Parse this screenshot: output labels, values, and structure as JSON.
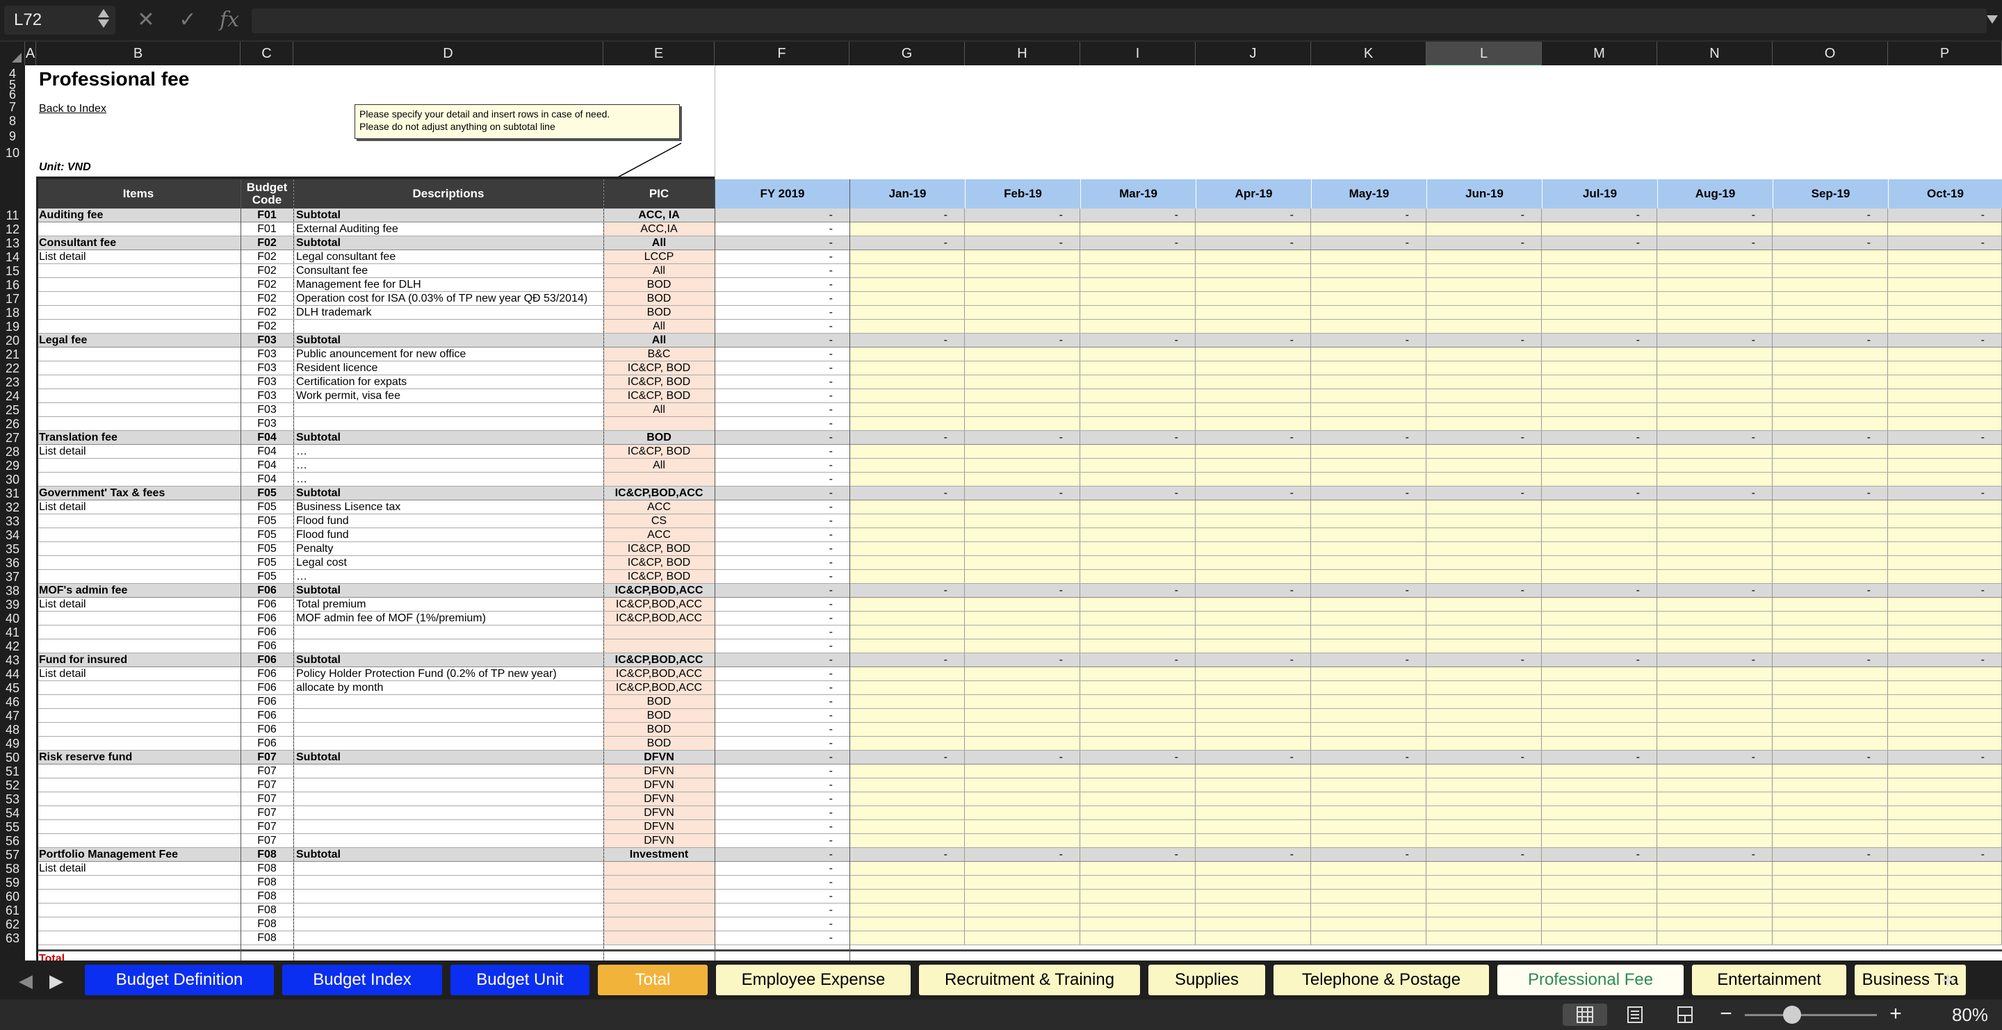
{
  "formula_bar": {
    "name_box": "L72",
    "cancel_icon": "✕",
    "enter_icon": "✓",
    "fx_label": "fx",
    "formula": ""
  },
  "columns": [
    "A",
    "B",
    "C",
    "D",
    "E",
    "F",
    "G",
    "H",
    "I",
    "J",
    "K",
    "L",
    "M",
    "N",
    "O",
    "P"
  ],
  "selected_column": "L",
  "title": "Professional fee",
  "back_link": "Back to Index",
  "unit": "Unit: VND",
  "note": {
    "line1": "Please specify your detail and insert rows in case of need.",
    "line2": "Please do not adjust anything on subtotal line"
  },
  "headers": {
    "items": "Items",
    "budget_code": "Budget Code",
    "descriptions": "Descriptions",
    "pic": "PIC"
  },
  "months": [
    "FY 2019",
    "Jan-19",
    "Feb-19",
    "Mar-19",
    "Apr-19",
    "May-19",
    "Jun-19",
    "Jul-19",
    "Aug-19",
    "Sep-19",
    "Oct-19"
  ],
  "top_row_numbers": [
    "4",
    "5",
    "6",
    "7",
    "8",
    "9",
    "10"
  ],
  "rows": [
    {
      "n": "11",
      "item": "Auditing fee",
      "code": "F01",
      "desc": "Subtotal",
      "pic": "ACC, IA",
      "sub": true
    },
    {
      "n": "12",
      "item": "",
      "code": "F01",
      "desc": "External Auditing fee",
      "pic": "ACC,IA",
      "sub": false
    },
    {
      "n": "13",
      "item": "Consultant fee",
      "code": "F02",
      "desc": "Subtotal",
      "pic": "All",
      "sub": true
    },
    {
      "n": "14",
      "item": "List detail",
      "code": "F02",
      "desc": "Legal consultant fee",
      "pic": "LCCP",
      "sub": false
    },
    {
      "n": "15",
      "item": "",
      "code": "F02",
      "desc": "Consultant fee",
      "pic": "All",
      "sub": false
    },
    {
      "n": "16",
      "item": "",
      "code": "F02",
      "desc": "Management fee for DLH",
      "pic": "BOD",
      "sub": false
    },
    {
      "n": "17",
      "item": "",
      "code": "F02",
      "desc": "Operation cost for ISA (0.03% of TP new year QĐ 53/2014)",
      "pic": "BOD",
      "sub": false
    },
    {
      "n": "18",
      "item": "",
      "code": "F02",
      "desc": "DLH trademark",
      "pic": "BOD",
      "sub": false
    },
    {
      "n": "19",
      "item": "",
      "code": "F02",
      "desc": "",
      "pic": "All",
      "sub": false
    },
    {
      "n": "20",
      "item": "Legal fee",
      "code": "F03",
      "desc": "Subtotal",
      "pic": "All",
      "sub": true
    },
    {
      "n": "21",
      "item": "",
      "code": "F03",
      "desc": "Public anouncement for new office",
      "pic": "B&C",
      "sub": false
    },
    {
      "n": "22",
      "item": "",
      "code": "F03",
      "desc": "Resident licence",
      "pic": "IC&CP, BOD",
      "sub": false
    },
    {
      "n": "23",
      "item": "",
      "code": "F03",
      "desc": "Certification for expats",
      "pic": "IC&CP, BOD",
      "sub": false
    },
    {
      "n": "24",
      "item": "",
      "code": "F03",
      "desc": "Work permit, visa fee",
      "pic": "IC&CP, BOD",
      "sub": false
    },
    {
      "n": "25",
      "item": "",
      "code": "F03",
      "desc": "",
      "pic": "All",
      "sub": false
    },
    {
      "n": "26",
      "item": "",
      "code": "F03",
      "desc": "",
      "pic": "",
      "sub": false
    },
    {
      "n": "27",
      "item": "Translation fee",
      "code": "F04",
      "desc": "Subtotal",
      "pic": "BOD",
      "sub": true
    },
    {
      "n": "28",
      "item": "List detail",
      "code": "F04",
      "desc": "…",
      "pic": "IC&CP, BOD",
      "sub": false
    },
    {
      "n": "29",
      "item": "",
      "code": "F04",
      "desc": "…",
      "pic": "All",
      "sub": false
    },
    {
      "n": "30",
      "item": "",
      "code": "F04",
      "desc": "…",
      "pic": "",
      "sub": false
    },
    {
      "n": "31",
      "item": "Government' Tax & fees",
      "code": "F05",
      "desc": "Subtotal",
      "pic": "IC&CP,BOD,ACC",
      "sub": true
    },
    {
      "n": "32",
      "item": "List detail",
      "code": "F05",
      "desc": "Business Lisence tax",
      "pic": "ACC",
      "sub": false
    },
    {
      "n": "33",
      "item": "",
      "code": "F05",
      "desc": "Flood fund",
      "pic": "CS",
      "sub": false
    },
    {
      "n": "34",
      "item": "",
      "code": "F05",
      "desc": "Flood fund",
      "pic": "ACC",
      "sub": false
    },
    {
      "n": "35",
      "item": "",
      "code": "F05",
      "desc": "Penalty",
      "pic": "IC&CP, BOD",
      "sub": false
    },
    {
      "n": "36",
      "item": "",
      "code": "F05",
      "desc": "Legal cost",
      "pic": "IC&CP, BOD",
      "sub": false
    },
    {
      "n": "37",
      "item": "",
      "code": "F05",
      "desc": "…",
      "pic": "IC&CP, BOD",
      "sub": false
    },
    {
      "n": "38",
      "item": "MOF's admin fee",
      "code": "F06",
      "desc": "Subtotal",
      "pic": "IC&CP,BOD,ACC",
      "sub": true
    },
    {
      "n": "39",
      "item": "List detail",
      "code": "F06",
      "desc": "Total premium",
      "pic": "IC&CP,BOD,ACC",
      "sub": false
    },
    {
      "n": "40",
      "item": "",
      "code": "F06",
      "desc": "MOF admin fee of MOF (1%/premium)",
      "pic": "IC&CP,BOD,ACC",
      "sub": false
    },
    {
      "n": "41",
      "item": "",
      "code": "F06",
      "desc": "",
      "pic": "",
      "sub": false
    },
    {
      "n": "42",
      "item": "",
      "code": "F06",
      "desc": "",
      "pic": "",
      "sub": false
    },
    {
      "n": "43",
      "item": "Fund for insured",
      "code": "F06",
      "desc": "Subtotal",
      "pic": "IC&CP,BOD,ACC",
      "sub": true
    },
    {
      "n": "44",
      "item": "List detail",
      "code": "F06",
      "desc": "Policy Holder Protection Fund (0.2% of TP new year)",
      "pic": "IC&CP,BOD,ACC",
      "sub": false
    },
    {
      "n": "45",
      "item": "",
      "code": "F06",
      "desc": "allocate by month",
      "pic": "IC&CP,BOD,ACC",
      "sub": false
    },
    {
      "n": "46",
      "item": "",
      "code": "F06",
      "desc": "",
      "pic": "BOD",
      "sub": false
    },
    {
      "n": "47",
      "item": "",
      "code": "F06",
      "desc": "",
      "pic": "BOD",
      "sub": false
    },
    {
      "n": "48",
      "item": "",
      "code": "F06",
      "desc": "",
      "pic": "BOD",
      "sub": false
    },
    {
      "n": "49",
      "item": "",
      "code": "F06",
      "desc": "",
      "pic": "BOD",
      "sub": false
    },
    {
      "n": "50",
      "item": "Risk reserve fund",
      "code": "F07",
      "desc": "Subtotal",
      "pic": "DFVN",
      "sub": true
    },
    {
      "n": "51",
      "item": "",
      "code": "F07",
      "desc": "",
      "pic": "DFVN",
      "sub": false
    },
    {
      "n": "52",
      "item": "",
      "code": "F07",
      "desc": "",
      "pic": "DFVN",
      "sub": false
    },
    {
      "n": "53",
      "item": "",
      "code": "F07",
      "desc": "",
      "pic": "DFVN",
      "sub": false
    },
    {
      "n": "54",
      "item": "",
      "code": "F07",
      "desc": "",
      "pic": "DFVN",
      "sub": false
    },
    {
      "n": "55",
      "item": "",
      "code": "F07",
      "desc": "",
      "pic": "DFVN",
      "sub": false
    },
    {
      "n": "56",
      "item": "",
      "code": "F07",
      "desc": "",
      "pic": "DFVN",
      "sub": false
    },
    {
      "n": "57",
      "item": "Portfolio Management Fee",
      "code": "F08",
      "desc": "Subtotal",
      "pic": "Investment",
      "sub": true
    },
    {
      "n": "58",
      "item": "List detail",
      "code": "F08",
      "desc": "",
      "pic": "",
      "sub": false
    },
    {
      "n": "59",
      "item": "",
      "code": "F08",
      "desc": "",
      "pic": "",
      "sub": false
    },
    {
      "n": "60",
      "item": "",
      "code": "F08",
      "desc": "",
      "pic": "",
      "sub": false
    },
    {
      "n": "61",
      "item": "",
      "code": "F08",
      "desc": "",
      "pic": "",
      "sub": false
    },
    {
      "n": "62",
      "item": "",
      "code": "F08",
      "desc": "",
      "pic": "",
      "sub": false
    },
    {
      "n": "63",
      "item": "",
      "code": "F08",
      "desc": "",
      "pic": "",
      "sub": false
    }
  ],
  "dash_value": "-",
  "total_label": "Total",
  "tabs": [
    {
      "label": "Budget Definition",
      "style": "blue"
    },
    {
      "label": "Budget Index",
      "style": "blue"
    },
    {
      "label": "Budget Unit",
      "style": "blue"
    },
    {
      "label": "Total",
      "style": "orange"
    },
    {
      "label": "Employee Expense",
      "style": "yellow"
    },
    {
      "label": "Recruitment & Training",
      "style": "yellow"
    },
    {
      "label": "Supplies",
      "style": "yellow"
    },
    {
      "label": "Telephone & Postage",
      "style": "yellow"
    },
    {
      "label": "Professional Fee",
      "style": "active"
    },
    {
      "label": "Entertainment",
      "style": "yellow"
    },
    {
      "label": "Business Tra",
      "style": "yellow"
    }
  ],
  "add_sheet": "+",
  "zoom": {
    "minus": "−",
    "plus": "+",
    "level": "80%",
    "fraction": 0.36
  },
  "colors": {
    "subtotal_row": "#d9d9d9",
    "pic_fill": "#fce4d6",
    "month_fill": "#fdfcd2",
    "header_dark": "#3c3c3c",
    "header_blue": "#a7c9f0",
    "accent_green": "#2e8b57"
  }
}
